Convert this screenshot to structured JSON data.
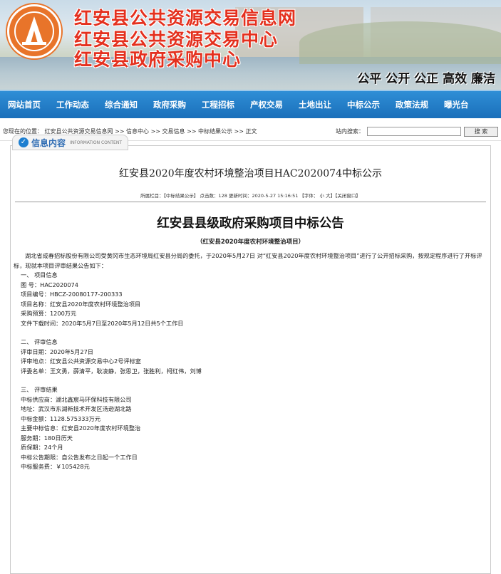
{
  "header": {
    "title_line1": "红安县公共资源交易信息网",
    "title_line2": "红安县公共资源交易中心",
    "title_line3": "红安县政府采购中心",
    "slogan": "公平 公开 公正 高效 廉洁"
  },
  "nav": [
    "网站首页",
    "工作动态",
    "综合通知",
    "政府采购",
    "工程招标",
    "产权交易",
    "土地出让",
    "中标公示",
    "政策法规",
    "曝光台"
  ],
  "breadcrumb": {
    "path": "您现在的位置：  红安县公共资源交易信息网 >> 信息中心 >> 交易信息 >> 中标结果公示 >> 正文",
    "search_label": "站内搜索：",
    "search_value": "",
    "search_button": "搜 索"
  },
  "panel": {
    "tab_label": "信息内容",
    "tab_sub": "INFORMATION CONTENT"
  },
  "article": {
    "title": "红安县2020年度农村环境整治项目HAC2020074中标公示",
    "meta_text": "所属栏目：【中标结果公示】 点击数：128 更新时间：2020-5-27 15:16:51 【字体： ",
    "font_small": "小",
    "font_large": "大",
    "meta_close": "】【关闭窗口】"
  },
  "announcement": {
    "title": "红安县县级政府采购项目中标公告",
    "subtitle": "（红安县2020年度农村环境整治项目）",
    "intro": "湖北省成春招标股份有限公司受黄冈市生态环境局红安县分局的委托，于2020年5月27日 对“红安县2020年度农村环境整治项目”进行了公开招标采购，按规定程序进行了开标评标，现就本项目评审结果公告如下：",
    "lines": [
      "一、 项目信息",
      "图    号：HAC2020074",
      "项目编号：HBCZ-20080177-200333",
      "项目名称：红安县2020年度农村环境整治项目",
      "采购预算：1200万元",
      "文件下载时间：2020年5月7日至2020年5月12日共5个工作日",
      "",
      "二、 评审信息",
      "评审日期：2020年5月27日",
      "评审地点：红安县公共资源交易中心2号评标室",
      "评委名单：王文勇，薛清平，耿凌静，张思卫，张胜利，柯红伟，刘博",
      "",
      "三、 评审结果",
      "中标供应商：湖北鑫宸马环保科技有限公司",
      "地址：武汉市东湖新技术开发区汤逊湖北路",
      "中标金额：1128.575333万元",
      "主要中标信息：红安县2020年度农村环境整治",
      "服务期：180日历天",
      "质保期：24个月",
      "中标公告期限：自公告发布之日起一个工作日",
      "中标服务费：￥105428元"
    ]
  },
  "colors": {
    "nav_blue": "#1a6fba",
    "banner_red": "#e4301e",
    "logo_orange": "#e8742a"
  }
}
